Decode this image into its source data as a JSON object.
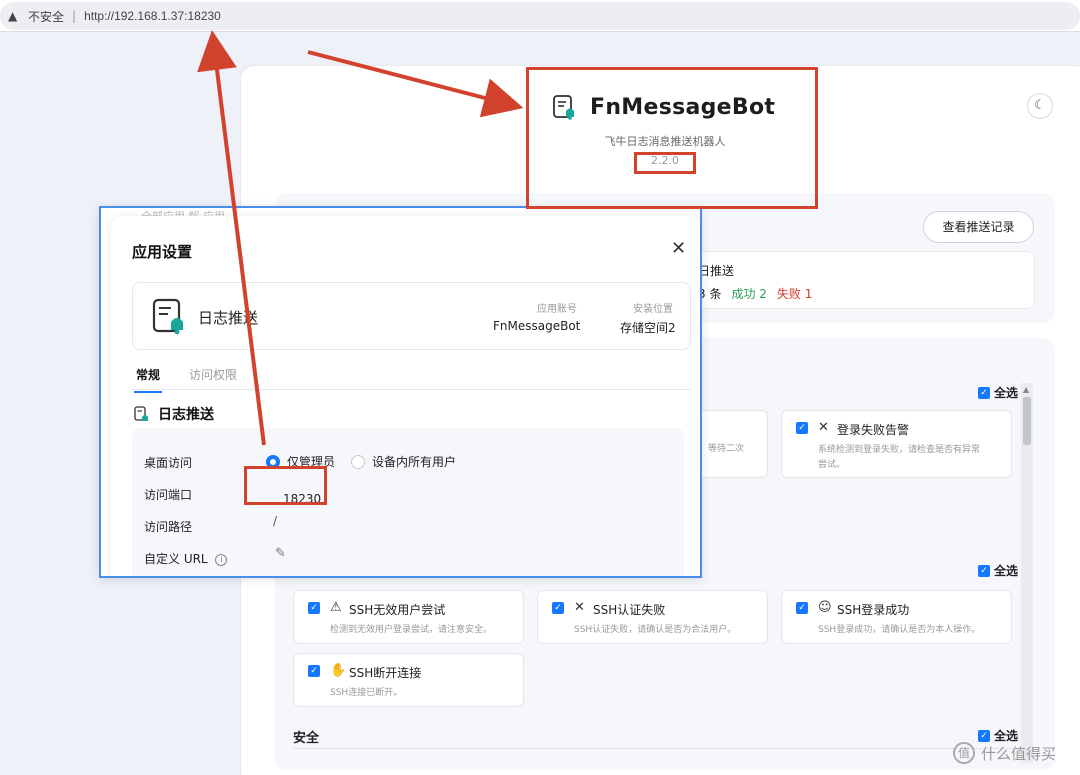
{
  "browser": {
    "insecure_label": "不安全",
    "url": "http://192.168.1.37:18230"
  },
  "app": {
    "title": "FnMessageBot",
    "subtitle": "飞牛日志消息推送机器人",
    "version": "2.2.0",
    "history_button": "查看推送记录",
    "stats": {
      "title": "日推送",
      "count": "3 条",
      "success": "成功 2",
      "fail": "失败 1"
    },
    "select_all": "全选",
    "security_section": "安全",
    "wait_text": "等待二次"
  },
  "events": [
    {
      "icon": "x-icon",
      "icon_char": "✕",
      "name": "登录失败告警",
      "desc1": "系统检测到登录失败，请检查是否有异常",
      "desc2": "尝试。"
    },
    {
      "icon": "warning-icon",
      "icon_char": "⚠",
      "name": "SSH无效用户尝试",
      "desc1": "检测到无效用户登录尝试，请注意安全。",
      "desc2": ""
    },
    {
      "icon": "x-icon",
      "icon_char": "✕",
      "name": "SSH认证失败",
      "desc1": "SSH认证失败，请确认是否为合法用户。",
      "desc2": ""
    },
    {
      "icon": "user-icon",
      "icon_char": "☺",
      "name": "SSH登录成功",
      "desc1": "SSH登录成功，请确认是否为本人操作。",
      "desc2": ""
    },
    {
      "icon": "wave-icon",
      "icon_char": "✋",
      "name": "SSH断开连接",
      "desc1": "SSH连接已断开。",
      "desc2": ""
    }
  ],
  "modal": {
    "ghost_tabs": "全部应用   解 应用",
    "title": "应用设置",
    "close": "✕",
    "app_name": "日志推送",
    "account_label": "应用账号",
    "account_value": "FnMessageBot",
    "location_label": "安装位置",
    "location_value": "存储空间2",
    "tab_general": "常规",
    "tab_access": "访问权限",
    "section_title": "日志推送",
    "desktop_access_label": "桌面访问",
    "option_admin": "仅管理员",
    "option_all": "设备内所有用户",
    "port_label": "访问端口",
    "port_value": "18230",
    "path_label": "访问路径",
    "path_value": "/",
    "custom_url_label": "自定义 URL"
  },
  "watermark": {
    "text": "什么值得买",
    "glyph": "值"
  },
  "colors": {
    "accent": "#1677ff",
    "annotation": "#d2432e",
    "success": "#2e9e5b",
    "fail": "#d33a2c"
  }
}
